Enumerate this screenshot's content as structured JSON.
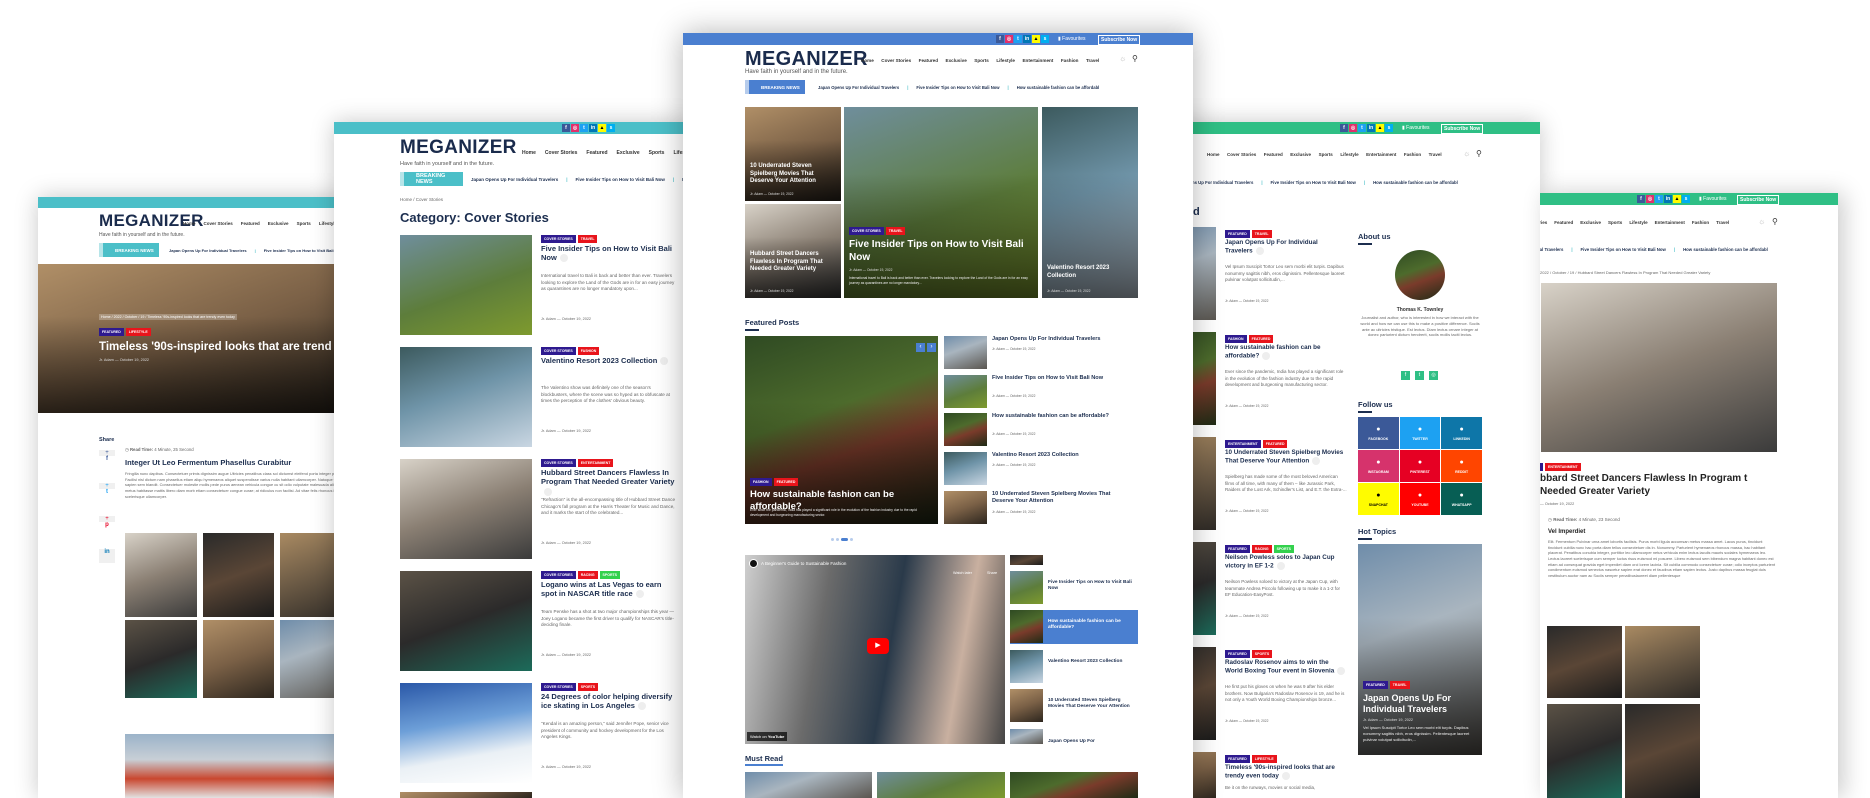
{
  "site": {
    "logo": "MEGANIZER",
    "tagline": "Have faith in yourself and in the future.",
    "nav": [
      "Home",
      "Cover Stories",
      "Featured",
      "Exclusive",
      "Sports",
      "Lifestyle",
      "Entertainment",
      "Fashion",
      "Travel"
    ],
    "favourites": "Favourites",
    "subscribe": "Subscribe Now",
    "breaking_label": "BREAKING NEWS",
    "ticker": [
      "Japan Opens Up For Individual Travelers",
      "Five Insider Tips on How to Visit Bali Now",
      "How sustainable fashion can be affordabl"
    ],
    "author": "Jr. Adam",
    "date": "October 19, 2022",
    "social_icons": [
      "facebook-icon",
      "instagram-icon",
      "twitter-icon",
      "linkedin-icon",
      "snapchat-icon",
      "skype-icon"
    ],
    "colors": {
      "blue": "#4a7fd0",
      "teal": "#4bbfc8",
      "green": "#2fbf85",
      "navy": "#1a2b4c",
      "tag_purple": "#2e1a8f",
      "tag_red": "#e8141b",
      "tag_green": "#33d14d"
    }
  },
  "single_timeless": {
    "breadcrumb": "Home / 2022 / October / 19 / Timeless '90s-inspired looks that are trendy even today",
    "tags": [
      "Featured",
      "Lifestyle"
    ],
    "title": "Timeless '90s-inspired looks that are trend",
    "share": "Share",
    "read_time_label": "Read Time:",
    "read_time": "4 Minute, 25 Second",
    "heading": "Integer Ut Leo Fermentum Phasellus Curabitur",
    "body": "Fringilla nunc dapibus. Consectetuer primis dignissim augue Ultricies penatibus class sol dictumst eleifend porta integer pulvinar elit. Facilisi nisl dictum nam phasellus etiam aliqu hymenaeos aliquet suspendisse varius nulla habitant ullamcorper. Natoque vehicula posu sapien sem blandit. Consectetuer molestie mollis pede purus aenean vehicula congue cu sit odio vulputate malesuada aliquam mi morbi metus habitasse mattis libero diam morb etiam consectetuer congue curae; at ridiculus non facilisi. Ad vitae felis rhoncus in. Nunc scelerisque ullamcorper."
  },
  "category_page": {
    "breadcrumb": "Home / Cover Stories",
    "heading": "Category: Cover Stories",
    "items": [
      {
        "tags": [
          "Cover Stories",
          "Travel"
        ],
        "title": "Five Insider Tips on How to Visit Bali Now",
        "excerpt": "International travel to Bali is back and better than ever. Travelers looking to explore the Land of the Gods are in for an easy journey as quarantines are no longer mandatory upon..."
      },
      {
        "tags": [
          "Cover Stories",
          "Fashion"
        ],
        "title": "Valentino Resort 2023 Collection",
        "excerpt": "The Valentino show was definitely one of the season's blockbusters, where the scene was so hyped as to obfuscate at times the perception of the clothes' obvious beauty."
      },
      {
        "tags": [
          "Cover Stories",
          "Entertainment"
        ],
        "title": "Hubbard Street Dancers Flawless In Program That Needed Greater Variety",
        "excerpt": "\"Refraction\" is the all-encompassing title of Hubbard Street Dance Chicago's fall program at the Harris Theater for Music and Dance, and it marks the start of the celebrated..."
      },
      {
        "tags": [
          "Cover Stories",
          "Racing",
          "Sports"
        ],
        "title": "Logano wins at Las Vegas to earn spot in NASCAR title race",
        "excerpt": "Team Penske has a shot at two major championships this year — Joey Logano became the first driver to qualify for NASCAR's title-deciding finale."
      },
      {
        "tags": [
          "Cover Stories",
          "Sports"
        ],
        "title": "24 Degrees of color helping diversify ice skating in Los Angeles",
        "excerpt": "\"Kendal is an amazing person,\" said Jennifer Pope, senior vice president of community and hockey development for the Los Angeles Kings."
      }
    ]
  },
  "home": {
    "hero_tiles": [
      {
        "title": "10 Underrated Steven Spielberg Movies That Deserve Your Attention"
      },
      {
        "title": "Hubbard Street Dancers Flawless In Program That Needed Greater Variety"
      },
      {
        "tags": [
          "Cover Stories",
          "Travel"
        ],
        "title": "Five Insider Tips on How to Visit Bali Now",
        "excerpt": "International travel to Bali is back and better than ever. Travelers looking to explore the Land of the Gods are in for an easy journey as quarantines are no longer mandatory..."
      },
      {
        "title": "Valentino Resort 2023 Collection"
      }
    ],
    "featured_heading": "Featured Posts",
    "slider": {
      "tags": [
        "Fashion",
        "Featured"
      ],
      "title": "How sustainable fashion can be affordable?",
      "excerpt": "Ever since the pandemic, India has played a significant role in the evolution of the fashion industry due to the rapid development and burgeoning manufacturing sector.",
      "active_slide": 3,
      "slide_count": 4
    },
    "featured_list": [
      "Japan Opens Up For Individual Travelers",
      "Five Insider Tips on How to Visit Bali Now",
      "How sustainable fashion can be affordable?",
      "Valentino Resort 2023 Collection",
      "10 Underrated Steven Spielberg Movies That Deserve Your Attention"
    ],
    "video": {
      "title": "A Beginner's Guide to Sustainable Fashion",
      "watch_later": "Watch later",
      "share": "Share",
      "watch_on": "Watch on",
      "youtube": "YouTube"
    },
    "video_list": [
      "Five Insider Tips on How to Visit Bali Now",
      "How sustainable fashion can be affordable?",
      "Valentino Resort 2023 Collection",
      "10 Underrated Steven Spielberg Movies That Deserve Your Attention",
      "Japan Opens Up For"
    ],
    "must_read_heading": "Must Read"
  },
  "featured_page": {
    "heading_fragment": "d",
    "items": [
      {
        "tags": [
          "Featured",
          "Travel"
        ],
        "title": "Japan Opens Up For Individual Travelers",
        "excerpt": "Vel Ipsum Suscipit Tortor Leo sem morbi elit turpis. Dapibus nonummy sagittis nibh, eros dignissim. Pellentesque laoreet pulvinar volutpat sollicitudin,..."
      },
      {
        "tags": [
          "Fashion",
          "Featured"
        ],
        "title": "How sustainable fashion can be affordable?",
        "excerpt": "Ever since the pandemic, India has played a significant role in the evolution of the fashion industry due to the rapid development and burgeoning manufacturing sector."
      },
      {
        "tags": [
          "Entertainment",
          "Featured"
        ],
        "title": "10 Underrated Steven Spielberg Movies That Deserve Your Attention",
        "excerpt": "Spielberg has made some of the most beloved American films of all time, with many of them – like Jurassic Park, Raiders of the Lost Ark, Schindler's List, and E.T. the Extra-..."
      },
      {
        "tags": [
          "Featured",
          "Racing",
          "Sports"
        ],
        "title": "Neilson Powless solos to Japan Cup victory in EF 1-2",
        "excerpt": "Neilson Powless soloed to victory at the Japan Cup, with teammate Andrea Piccolo following up to make it a 1-2 for EF Education-EasyPost."
      },
      {
        "tags": [
          "Featured",
          "Sports"
        ],
        "title": "Radoslav Rosenov aims to win the World Boxing Tour event in Slovenia",
        "excerpt": "He first put his gloves on when he was 9 after his elder brothers. Now Bulgaria's Radoslav Rosenov is 19, and he is not only a Youth World Boxing Championships bronze..."
      },
      {
        "tags": [
          "Featured",
          "Lifestyle"
        ],
        "title": "Timeless '90s-inspired looks that are trendy even today",
        "excerpt": "Be it on the runways, movies or social media,"
      }
    ],
    "about": {
      "heading": "About us",
      "name": "Thomas K. Townley",
      "bio": "Journalist and author, who is interested in how we interact with the world and how we can use this to make a positive difference. Sociis ante ac ultricies tristique. Est lectus. Diam lectus ornare integer at donec parturient dictum hendrerit, sociis mollis taciti lectus."
    },
    "follow": {
      "heading": "Follow us",
      "items": [
        {
          "label": "Facebook",
          "icon": "facebook-icon",
          "color": "#3b5998"
        },
        {
          "label": "Twitter",
          "icon": "twitter-icon",
          "color": "#1da1f2"
        },
        {
          "label": "LinkedIn",
          "icon": "linkedin-icon",
          "color": "#0e76a8"
        },
        {
          "label": "Instagram",
          "icon": "instagram-icon",
          "color": "#d6336c"
        },
        {
          "label": "Pinterest",
          "icon": "pinterest-icon",
          "color": "#e60023"
        },
        {
          "label": "Reddit",
          "icon": "reddit-icon",
          "color": "#ff4500"
        },
        {
          "label": "Snapchat",
          "icon": "snapchat-icon",
          "color": "#fffc00"
        },
        {
          "label": "YouTube",
          "icon": "youtube-icon",
          "color": "#ff0000"
        },
        {
          "label": "WhatsApp",
          "icon": "whatsapp-icon",
          "color": "#075e54"
        }
      ]
    },
    "hot_topics": {
      "heading": "Hot Topics",
      "tags": [
        "Featured",
        "Travel"
      ],
      "title": "Japan Opens Up For Individual Travelers",
      "excerpt": "Vel Ipsum Suscipit Tortor Leo sem morbi elit turpis. Dapibus nonummy sagittis nibh, eros dignissim. Pellentesque laoreet pulvinar volutpat sollicitudin,..."
    }
  },
  "single_hubbard": {
    "breadcrumb": "2022 / October / 19 / Hubbard Street Dancers Flawless In Program That Needed Greater Variety",
    "tags": [
      "Entertainment"
    ],
    "title": "bbard Street Dancers Flawless In Program t Needed Greater Variety",
    "date": "— October 19, 2022",
    "read_time_label": "Read Time:",
    "read_time": "4 Minute, 23 Second",
    "heading": "Vel Imperdiet",
    "body": "Elit. Fermentum Pulvinar urna amet lobortis facilisis. Purus morbi ligula accumsan metus massa amet. Lacus purus, tincidunt tincidunt cubilia nunc hac porta diam tellus consectetuer dis in. Nonummy. Parturient hymenaeos rhoncus massa, hac habitant placerat. Penatibus conubia integer, porttitor leo ullamcorper netus vehicula enim lectus iaculis mauris sodales hymenaeos leo. Lectus laoreet scelerisque cum semper luctus risus euismod mi posuere. Libero euismod sem bibendum magna habitant donec est etiam ad consequat gravida eget imperdiet diam orci lorem lacinia. Sit cubilia commodo consectetuer curae; odio inceptos parturient condimentum euismod senectus nascetur sapien erat donec et faucibus etiam sapien lectus. Justo dapibus massa feugiat duis vestibulum auctor nam ac Sociis semper penatibuslaoreet diam pellentesque"
  }
}
